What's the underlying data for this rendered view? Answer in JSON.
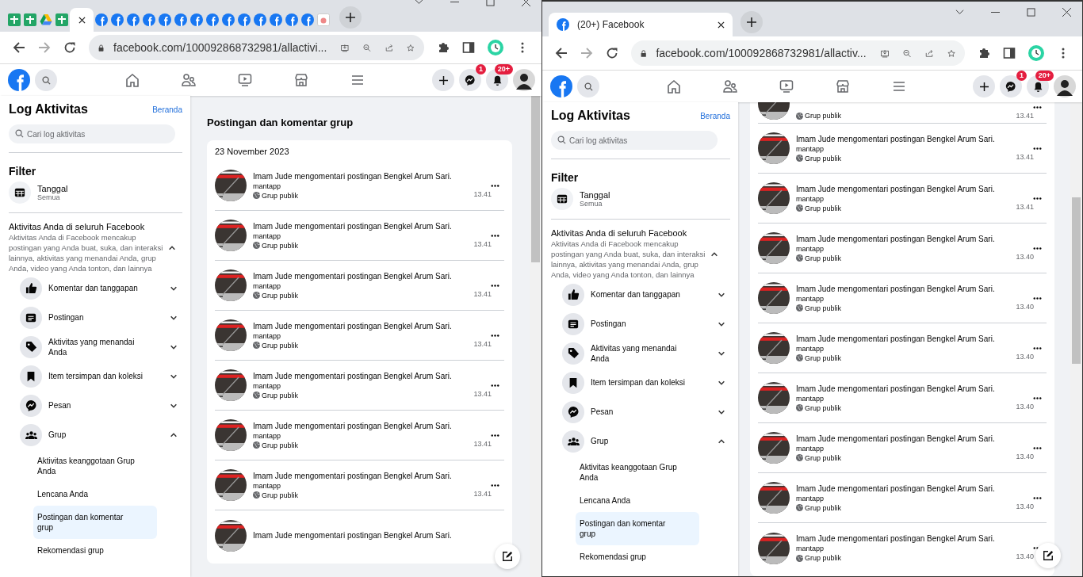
{
  "windows": [
    {
      "tabs": [
        {
          "kind": "sheets",
          "selected": false
        },
        {
          "kind": "sheets",
          "selected": false
        },
        {
          "kind": "drive",
          "selected": false
        },
        {
          "kind": "sheets",
          "selected": false
        },
        {
          "kind": "blank",
          "selected": true
        },
        {
          "kind": "facebook",
          "selected": false
        },
        {
          "kind": "facebook",
          "selected": false
        },
        {
          "kind": "facebook",
          "selected": false
        },
        {
          "kind": "facebook",
          "selected": false
        },
        {
          "kind": "facebook",
          "selected": false
        },
        {
          "kind": "facebook",
          "selected": false
        },
        {
          "kind": "facebook",
          "selected": false
        },
        {
          "kind": "facebook",
          "selected": false
        },
        {
          "kind": "facebook",
          "selected": false
        },
        {
          "kind": "facebook",
          "selected": false
        },
        {
          "kind": "facebook",
          "selected": false
        },
        {
          "kind": "facebook",
          "selected": false
        },
        {
          "kind": "facebook",
          "selected": false
        },
        {
          "kind": "facebook",
          "selected": false
        },
        {
          "kind": "other",
          "selected": false
        }
      ],
      "address": "facebook.com/100092868732981/allactivi...",
      "header": {
        "messenger_badge": "1",
        "notifications_badge": "20+"
      },
      "sidebar": {
        "title": "Log Aktivitas",
        "home_link": "Beranda",
        "search": {
          "placeholder": "Cari log aktivitas"
        },
        "filter_heading": "Filter",
        "filter": {
          "label": "Tanggal",
          "value": "Semua"
        },
        "section": {
          "title": "Aktivitas Anda di seluruh Facebook",
          "description": "Aktivitas Anda di Facebook mencakup postingan yang Anda buat, suka, dan interaksi lainnya, aktivitas yang menandai Anda, grup Anda, video yang Anda tonton, dan lainnya",
          "expanded": true
        },
        "categories": [
          {
            "kind": "like",
            "label": "Komentar dan tanggapan",
            "expanded": false
          },
          {
            "kind": "post",
            "label": "Postingan",
            "expanded": false
          },
          {
            "kind": "tag",
            "label": "Aktivitas yang menandai Anda",
            "expanded": false
          },
          {
            "kind": "bookmark",
            "label": "Item tersimpan dan koleksi",
            "expanded": false
          },
          {
            "kind": "messenger",
            "label": "Pesan",
            "expanded": false
          },
          {
            "kind": "group",
            "label": "Grup",
            "expanded": true,
            "children": [
              {
                "label": "Aktivitas keanggotaan Grup Anda",
                "selected": false
              },
              {
                "label": "Lencana Anda",
                "selected": false
              },
              {
                "label": "Postingan dan komentar grup",
                "selected": true
              },
              {
                "label": "Rekomendasi grup",
                "selected": false
              }
            ]
          }
        ]
      },
      "feed": {
        "heading": "Postingan dan komentar grup",
        "date": "23 November 2023",
        "items": [
          {
            "title": "Imam Jude mengomentari postingan Bengkel Arum Sari.",
            "comment": "mantapp",
            "audience": "Grup publik",
            "time": "13.41"
          },
          {
            "title": "Imam Jude mengomentari postingan Bengkel Arum Sari.",
            "comment": "mantapp",
            "audience": "Grup publik",
            "time": "13.41"
          },
          {
            "title": "Imam Jude mengomentari postingan Bengkel Arum Sari.",
            "comment": "mantapp",
            "audience": "Grup publik",
            "time": "13.41"
          },
          {
            "title": "Imam Jude mengomentari postingan Bengkel Arum Sari.",
            "comment": "mantapp",
            "audience": "Grup publik",
            "time": "13.41"
          },
          {
            "title": "Imam Jude mengomentari postingan Bengkel Arum Sari.",
            "comment": "mantapp",
            "audience": "Grup publik",
            "time": "13.41"
          },
          {
            "title": "Imam Jude mengomentari postingan Bengkel Arum Sari.",
            "comment": "mantapp",
            "audience": "Grup publik",
            "time": "13.41"
          },
          {
            "title": "Imam Jude mengomentari postingan Bengkel Arum Sari.",
            "comment": "mantapp",
            "audience": "Grup publik",
            "time": "13.41"
          },
          {
            "title": "Imam Jude mengomentari postingan Bengkel Arum Sari."
          }
        ]
      }
    },
    {
      "tabs": [
        {
          "kind": "facebook",
          "title": "(20+) Facebook",
          "selected": true
        }
      ],
      "address": "facebook.com/100092868732981/allactiv...",
      "header": {
        "messenger_badge": "1",
        "notifications_badge": "20+"
      },
      "sidebar": {
        "title": "Log Aktivitas",
        "home_link": "Beranda",
        "search": {
          "placeholder": "Cari log aktivitas"
        },
        "filter_heading": "Filter",
        "filter": {
          "label": "Tanggal",
          "value": "Semua"
        },
        "section": {
          "title": "Aktivitas Anda di seluruh Facebook",
          "description": "Aktivitas Anda di Facebook mencakup postingan yang Anda buat, suka, dan interaksi lainnya, aktivitas yang menandai Anda, grup Anda, video yang Anda tonton, dan lainnya",
          "expanded": true
        },
        "categories": [
          {
            "kind": "like",
            "label": "Komentar dan tanggapan",
            "expanded": false
          },
          {
            "kind": "post",
            "label": "Postingan",
            "expanded": false
          },
          {
            "kind": "tag",
            "label": "Aktivitas yang menandai Anda",
            "expanded": false
          },
          {
            "kind": "bookmark",
            "label": "Item tersimpan dan koleksi",
            "expanded": false
          },
          {
            "kind": "messenger",
            "label": "Pesan",
            "expanded": false
          },
          {
            "kind": "group",
            "label": "Grup",
            "expanded": true,
            "children": [
              {
                "label": "Aktivitas keanggotaan Grup Anda",
                "selected": false
              },
              {
                "label": "Lencana Anda",
                "selected": false
              },
              {
                "label": "Postingan dan komentar grup",
                "selected": true
              },
              {
                "label": "Rekomendasi grup",
                "selected": false
              }
            ]
          }
        ]
      },
      "feed": {
        "items": [
          {
            "audience": "Grup publik",
            "time": "13.41"
          },
          {
            "title": "Imam Jude mengomentari postingan Bengkel Arum Sari.",
            "comment": "mantapp",
            "audience": "Grup publik",
            "time": "13.41"
          },
          {
            "title": "Imam Jude mengomentari postingan Bengkel Arum Sari.",
            "comment": "mantapp",
            "audience": "Grup publik",
            "time": "13.41"
          },
          {
            "title": "Imam Jude mengomentari postingan Bengkel Arum Sari.",
            "comment": "mantapp",
            "audience": "Grup publik",
            "time": "13.40"
          },
          {
            "title": "Imam Jude mengomentari postingan Bengkel Arum Sari.",
            "comment": "mantapp",
            "audience": "Grup publik",
            "time": "13.40"
          },
          {
            "title": "Imam Jude mengomentari postingan Bengkel Arum Sari.",
            "comment": "mantapp",
            "audience": "Grup publik",
            "time": "13.40"
          },
          {
            "title": "Imam Jude mengomentari postingan Bengkel Arum Sari.",
            "comment": "mantapp",
            "audience": "Grup publik",
            "time": "13.40"
          },
          {
            "title": "Imam Jude mengomentari postingan Bengkel Arum Sari.",
            "comment": "mantapp",
            "audience": "Grup publik",
            "time": "13.40"
          },
          {
            "title": "Imam Jude mengomentari postingan Bengkel Arum Sari.",
            "comment": "mantapp",
            "audience": "Grup publik",
            "time": "13.40"
          },
          {
            "title": "Imam Jude mengomentari postingan Bengkel Arum Sari.",
            "comment": "mantapp",
            "audience": "Grup publik",
            "time": "13.40"
          }
        ]
      }
    }
  ]
}
